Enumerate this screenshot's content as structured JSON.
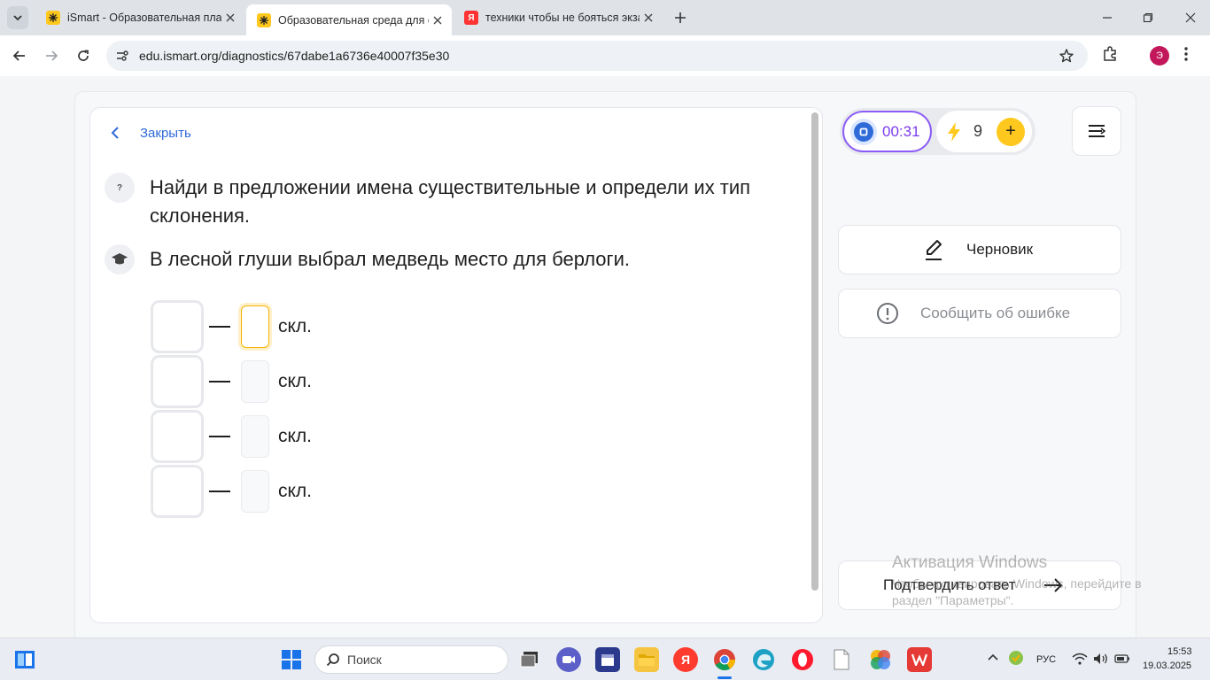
{
  "browser": {
    "tabs": [
      {
        "title": "iSmart - Образовательная пла",
        "active": false,
        "favicon": "ismart-icon"
      },
      {
        "title": "Образовательная среда для са",
        "active": true,
        "favicon": "ismart-icon"
      },
      {
        "title": "техники чтобы не бояться экза",
        "active": false,
        "favicon": "yandex-icon"
      }
    ],
    "url": "edu.ismart.org/diagnostics/67dabe1a6736e40007f35e30",
    "profile_initial": "Э",
    "yandex_letter": "Я"
  },
  "task": {
    "back_label": "Закрыть",
    "question_icon": "?",
    "question": "Найди в предложении имена существительные и определи их тип склонения.",
    "sentence": "В лесной глуши выбрал медведь место для берлоги.",
    "suffix_label": "скл.",
    "rows": [
      {
        "word": "",
        "declension": "",
        "focused": true
      },
      {
        "word": "",
        "declension": "",
        "focused": false
      },
      {
        "word": "",
        "declension": "",
        "focused": false
      },
      {
        "word": "",
        "declension": "",
        "focused": false
      }
    ]
  },
  "sidebar": {
    "timer": "00:31",
    "energy": "9",
    "energy_plus": "+",
    "draft_label": "Черновик",
    "report_label": "Сообщить об ошибке",
    "confirm_label": "Подтвердить ответ"
  },
  "watermark": {
    "title": "Активация Windows",
    "subtitle": "Чтобы активировать Windows, перейдите в раздел \"Параметры\"."
  },
  "taskbar": {
    "search_label": "Поиск",
    "lang": "РУС",
    "time": "15:53",
    "date": "19.03.2025"
  },
  "colors": {
    "accent_blue": "#2f6ad9",
    "timer_purple": "#7c3aed",
    "energy_yellow": "#ffc81e",
    "focus_orange": "#f5b200"
  }
}
